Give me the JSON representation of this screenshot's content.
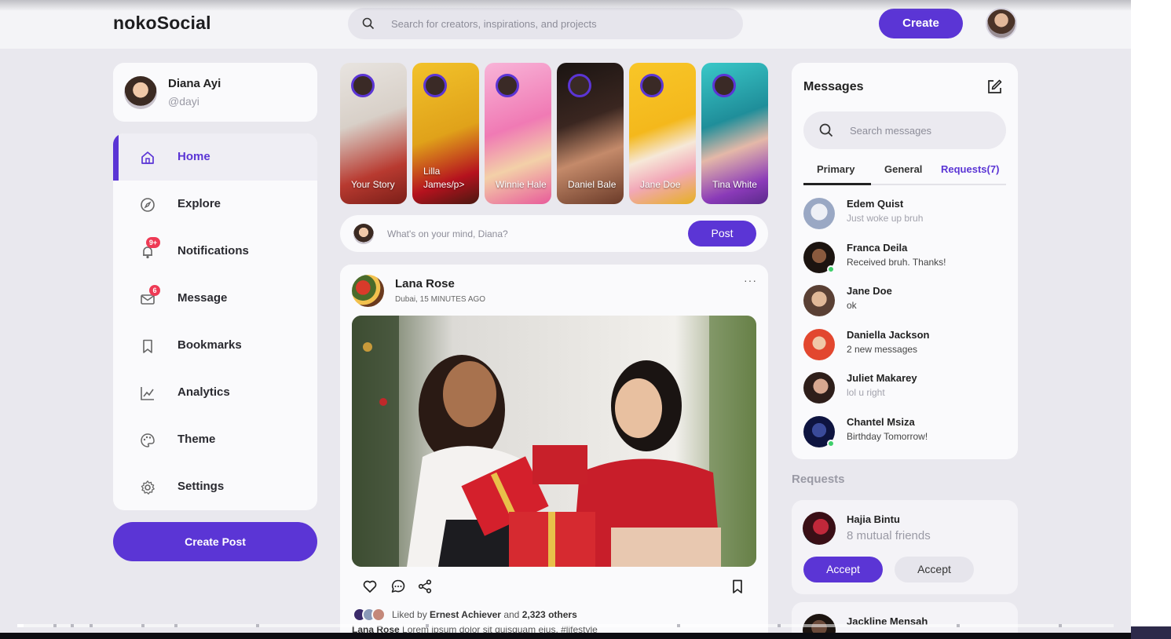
{
  "app": {
    "logo": "nokoSocial"
  },
  "topnav": {
    "search_placeholder": "Search for creators, inspirations, and projects",
    "create_label": "Create"
  },
  "profile": {
    "name": "Diana Ayi",
    "handle": "@dayi"
  },
  "sidebar": {
    "active": "Home",
    "items": [
      {
        "label": "Home",
        "icon": "home-icon"
      },
      {
        "label": "Explore",
        "icon": "compass-icon"
      },
      {
        "label": "Notifications",
        "icon": "bell-icon",
        "badge": "9+"
      },
      {
        "label": "Message",
        "icon": "envelope-icon",
        "badge": "6"
      },
      {
        "label": "Bookmarks",
        "icon": "bookmark-icon"
      },
      {
        "label": "Analytics",
        "icon": "chart-line-icon"
      },
      {
        "label": "Theme",
        "icon": "palette-icon"
      },
      {
        "label": "Settings",
        "icon": "gear-icon"
      }
    ],
    "create_post_label": "Create Post"
  },
  "stories": [
    {
      "name": "Your Story",
      "bg": "#c8342e"
    },
    {
      "name": "Lilla James/p>",
      "bg": "#e0a21a"
    },
    {
      "name": "Winnie Hale",
      "bg": "#f07ab4"
    },
    {
      "name": "Daniel Bale",
      "bg": "#2a1d1a"
    },
    {
      "name": "Jane Doe",
      "bg": "#f4b81c"
    },
    {
      "name": "Tina White",
      "bg": "#1f8e9a"
    }
  ],
  "composer": {
    "placeholder": "What's on your mind, Diana?",
    "post_label": "Post"
  },
  "feed": {
    "post": {
      "author": "Lana Rose",
      "meta": "Dubai, 15 MINUTES AGO",
      "more": "···",
      "liked_prefix": "Liked by",
      "liked_name": "Ernest Achiever",
      "liked_and": "and",
      "liked_others": "2,323 others",
      "caption_author": "Lana Rose",
      "caption_text": "Lorem ipsum dolor sit quisquam eius. #lifestyle"
    }
  },
  "messages": {
    "title": "Messages",
    "search_placeholder": "Search messages",
    "tabs": [
      "Primary",
      "General",
      "Requests(7)"
    ],
    "active_tab": "Primary",
    "items": [
      {
        "name": "Edem Quist",
        "text": "Just woke up bruh",
        "muted": true,
        "online": false,
        "color": "#b9c3d6"
      },
      {
        "name": "Franca Deila",
        "text": "Received bruh. Thanks!",
        "muted": false,
        "online": true,
        "color": "#2c2420"
      },
      {
        "name": "Jane Doe",
        "text": "ok",
        "muted": false,
        "online": false,
        "color": "#8a6d5c"
      },
      {
        "name": "Daniella Jackson",
        "text": "2 new messages",
        "muted": false,
        "online": false,
        "color": "#e2472f"
      },
      {
        "name": "Juliet Makarey",
        "text": "lol u right",
        "muted": true,
        "online": false,
        "color": "#3e2a24"
      },
      {
        "name": "Chantel Msiza",
        "text": "Birthday Tomorrow!",
        "muted": false,
        "online": true,
        "color": "#1a2a6b"
      }
    ]
  },
  "requests": {
    "title": "Requests",
    "items": [
      {
        "name": "Hajia Bintu",
        "mutual": "8 mutual friends",
        "accept_label": "Accept",
        "second_label": "Accept"
      },
      {
        "name": "Jackline Mensah"
      }
    ]
  },
  "colors": {
    "accent": "#5b35d5",
    "badge": "#ee3a55",
    "online": "#3fcf6b"
  }
}
